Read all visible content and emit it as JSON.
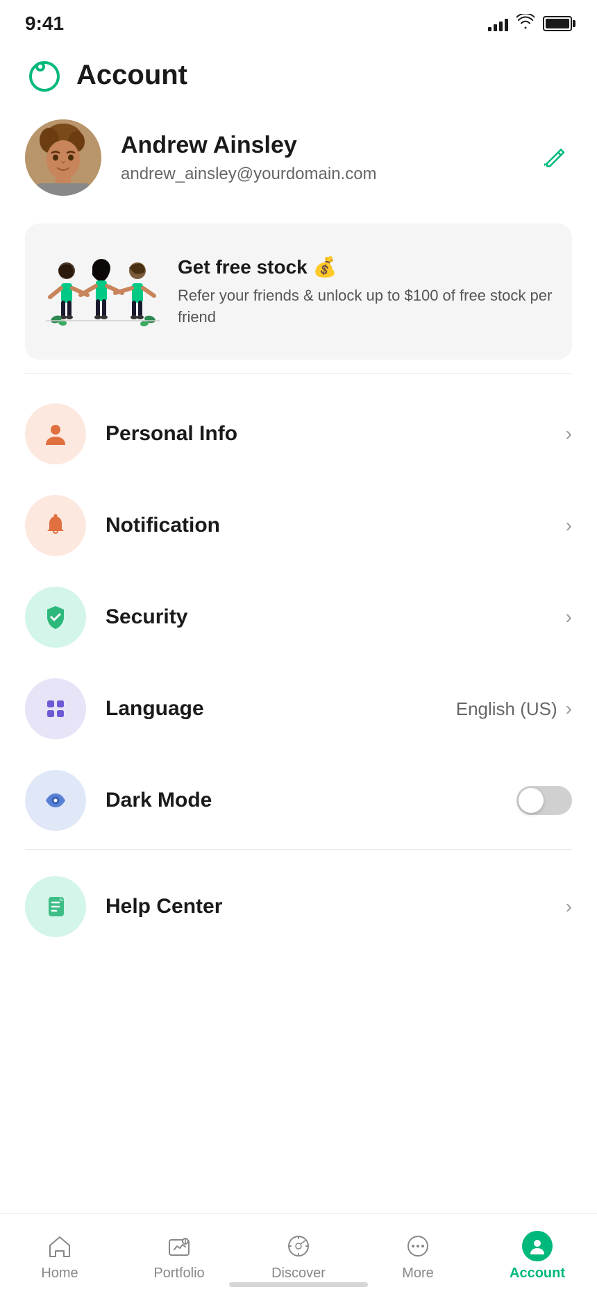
{
  "statusBar": {
    "time": "9:41",
    "signalBars": [
      4,
      8,
      12,
      16
    ],
    "batteryFull": true
  },
  "header": {
    "title": "Account"
  },
  "profile": {
    "name": "Andrew Ainsley",
    "email": "andrew_ainsley@yourdomain.com",
    "editLabel": "Edit"
  },
  "referral": {
    "title": "Get free stock 💰",
    "description": "Refer your friends & unlock up to $100 of free stock per friend"
  },
  "menuItems": [
    {
      "id": "personal-info",
      "label": "Personal Info",
      "iconBg": "orange-bg",
      "iconType": "person",
      "hasArrow": true,
      "value": ""
    },
    {
      "id": "notification",
      "label": "Notification",
      "iconBg": "orange-bg",
      "iconType": "bell",
      "hasArrow": true,
      "value": ""
    },
    {
      "id": "security",
      "label": "Security",
      "iconBg": "green-bg",
      "iconType": "shield",
      "hasArrow": true,
      "value": ""
    },
    {
      "id": "language",
      "label": "Language",
      "iconBg": "purple-bg",
      "iconType": "grid",
      "hasArrow": true,
      "value": "English (US)"
    },
    {
      "id": "dark-mode",
      "label": "Dark Mode",
      "iconBg": "blue-bg",
      "iconType": "eye",
      "hasArrow": false,
      "hasToggle": true,
      "toggleOn": false,
      "value": ""
    }
  ],
  "helpCenter": {
    "label": "Help Center",
    "iconBg": "teal-bg",
    "iconType": "doc"
  },
  "bottomNav": {
    "items": [
      {
        "id": "home",
        "label": "Home",
        "icon": "home",
        "active": false
      },
      {
        "id": "portfolio",
        "label": "Portfolio",
        "icon": "portfolio",
        "active": false
      },
      {
        "id": "discover",
        "label": "Discover",
        "icon": "discover",
        "active": false
      },
      {
        "id": "more",
        "label": "More",
        "icon": "more",
        "active": false
      },
      {
        "id": "account",
        "label": "Account",
        "icon": "account",
        "active": true
      }
    ]
  }
}
